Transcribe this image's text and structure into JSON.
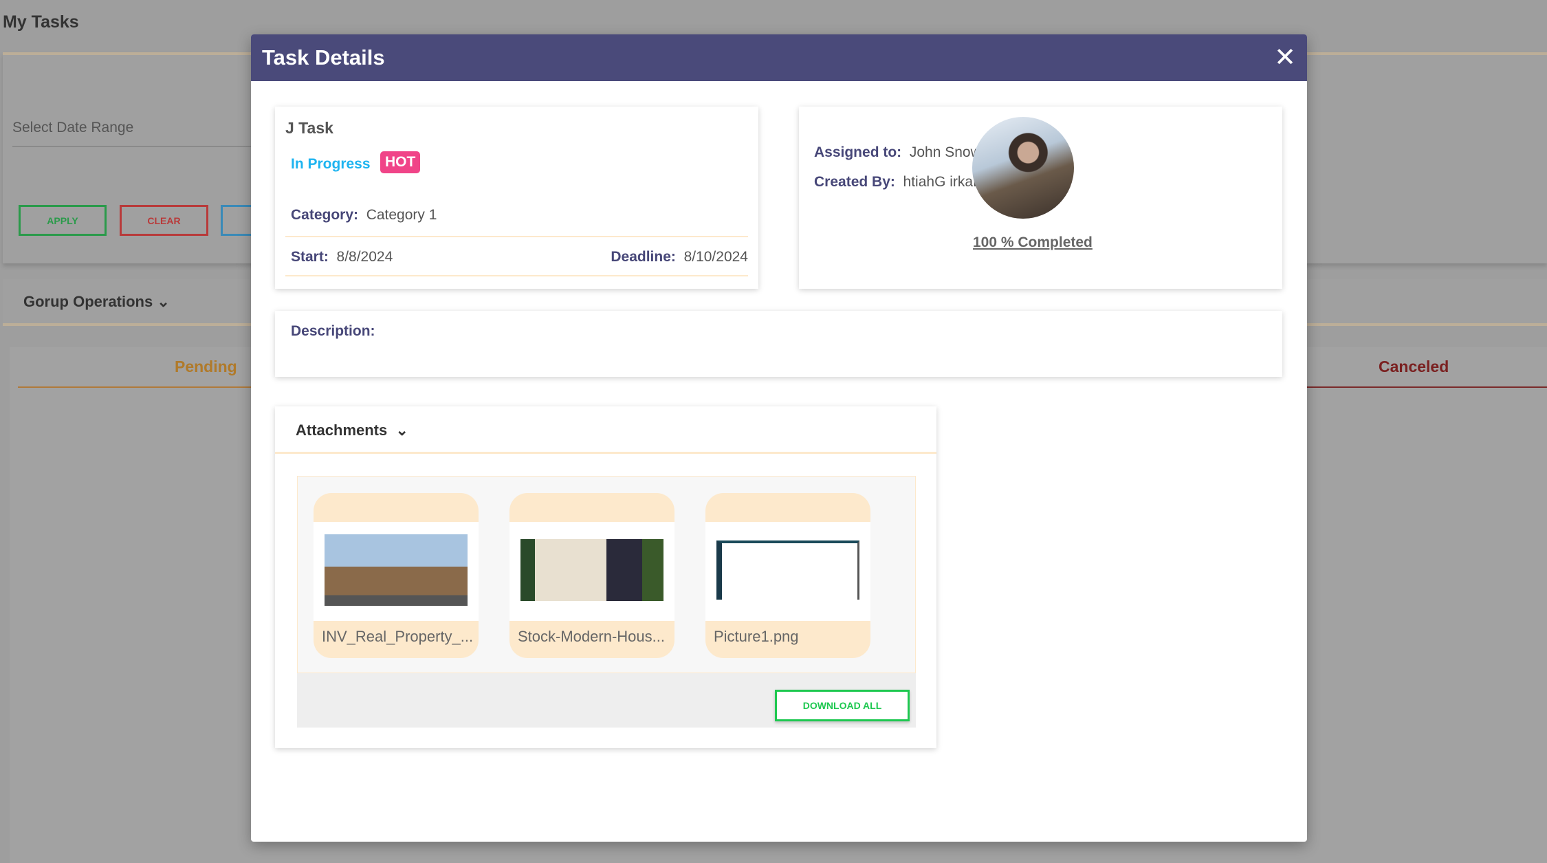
{
  "background": {
    "title": "My Tasks",
    "date_range_placeholder": "Select Date Range",
    "apply": "APPLY",
    "clear": "CLEAR",
    "group_operations": "Gorup Operations",
    "columns": {
      "pending": "Pending",
      "canceled": "Canceled"
    }
  },
  "modal": {
    "title": "Task Details",
    "task": {
      "name": "J Task",
      "status": "In Progress",
      "priority": "HOT",
      "category_label": "Category:",
      "category": "Category 1",
      "start_label": "Start:",
      "start": "8/8/2024",
      "deadline_label": "Deadline:",
      "deadline": "8/10/2024"
    },
    "people": {
      "assigned_label": "Assigned to:",
      "assigned": "John Snow",
      "created_label": "Created By:",
      "created": "htiahG irkaB lA",
      "progress": "100 % Completed",
      "progress_percent": 100
    },
    "description_label": "Description:",
    "attachments": {
      "title": "Attachments",
      "files": [
        "INV_Real_Property_...",
        "Stock-Modern-Hous...",
        "Picture1.png"
      ],
      "download_all": "DOWNLOAD ALL"
    }
  },
  "colors": {
    "header": "#4a4a7a",
    "status": "#1eb4f0",
    "hot": "#f04488",
    "download": "#1ec850",
    "tile": "#fde9cc"
  }
}
